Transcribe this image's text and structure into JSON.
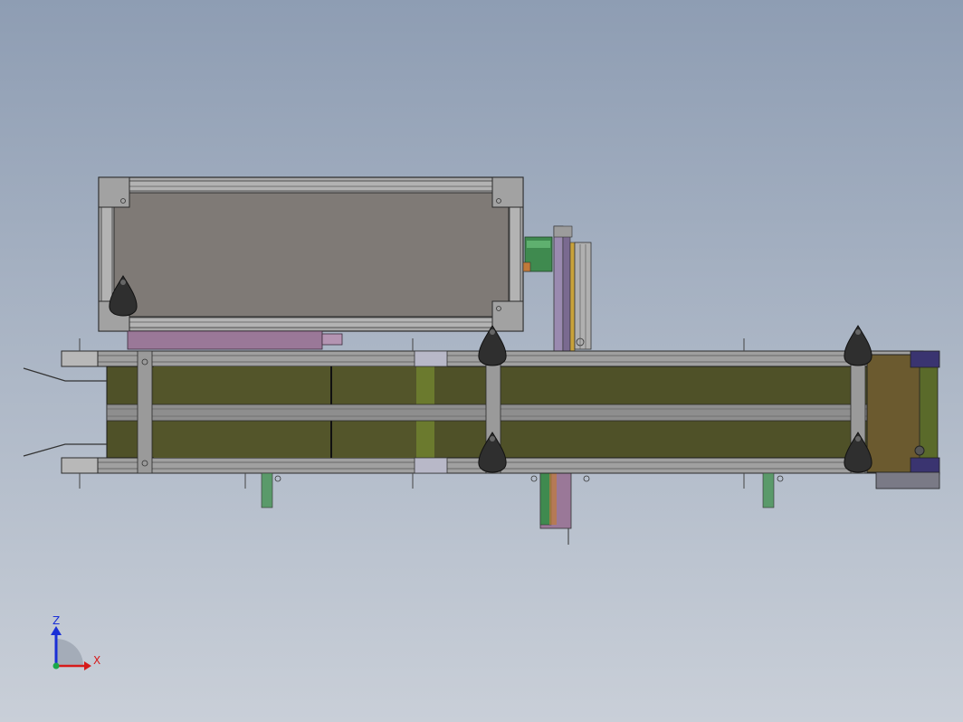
{
  "viewport": {
    "background_top": "#8e9db3",
    "background_bottom": "#c9cfd8"
  },
  "model": {
    "colors": {
      "belt": "#4f5128",
      "belt_light": "#6a6b2e",
      "frame": "#9a9a9a",
      "frame_dark": "#3c3c3c",
      "box_panel": "#7f7a76",
      "box_frame": "#a5a5a5",
      "knob": "#2f2f2f",
      "motor": "#6b5a2f",
      "motor_cap": "#3a3470",
      "cylinder": "#9a7a9a",
      "bracket_green": "#3f8a4f",
      "accent_yellow": "#c8a23a"
    }
  },
  "triad": {
    "axis_z_label": "Z",
    "axis_x_label": "X",
    "axis_z_color": "#1a2fd6",
    "axis_x_color": "#d61a1a",
    "axis_y_color": "#1aa84a"
  }
}
